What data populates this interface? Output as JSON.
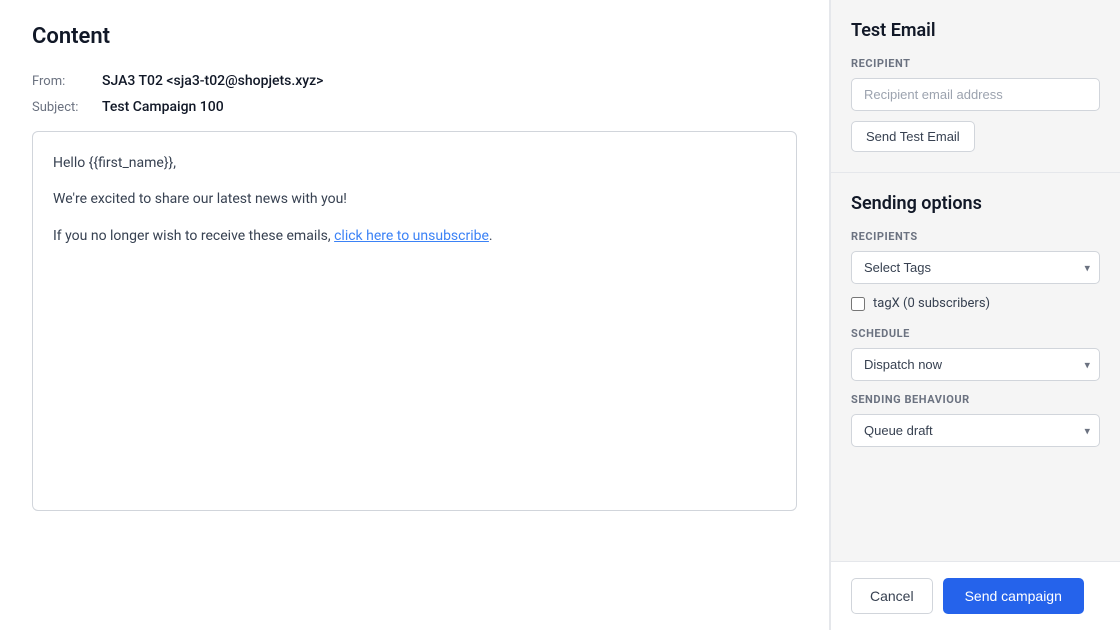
{
  "content": {
    "page_title": "Content",
    "from_label": "From:",
    "from_value": "SJA3 T02 <sja3-t02@shopjets.xyz>",
    "subject_label": "Subject:",
    "subject_value": "Test Campaign 100",
    "email_body": {
      "line1": "Hello {{first_name}},",
      "line2": "We're excited to share our latest news with you!",
      "line3_prefix": "If you no longer wish to receive these emails, ",
      "line3_link": "click here to unsubscribe",
      "line3_suffix": "."
    }
  },
  "test_email": {
    "section_title": "Test Email",
    "recipient_label": "RECIPIENT",
    "recipient_placeholder": "Recipient email address",
    "send_test_btn": "Send Test Email"
  },
  "sending_options": {
    "section_title": "Sending options",
    "recipients_label": "RECIPIENTS",
    "select_tags_placeholder": "Select Tags",
    "select_tags_options": [
      "Select Tags"
    ],
    "checkbox_label": "tagX (0 subscribers)",
    "schedule_label": "SCHEDULE",
    "dispatch_now_value": "Dispatch now",
    "schedule_options": [
      "Dispatch now"
    ],
    "sending_behaviour_label": "SENDING BEHAVIOUR",
    "sending_behaviour_value": "Queue draft",
    "behaviour_options": [
      "Queue draft"
    ],
    "cancel_btn": "Cancel",
    "send_campaign_btn": "Send campaign"
  }
}
